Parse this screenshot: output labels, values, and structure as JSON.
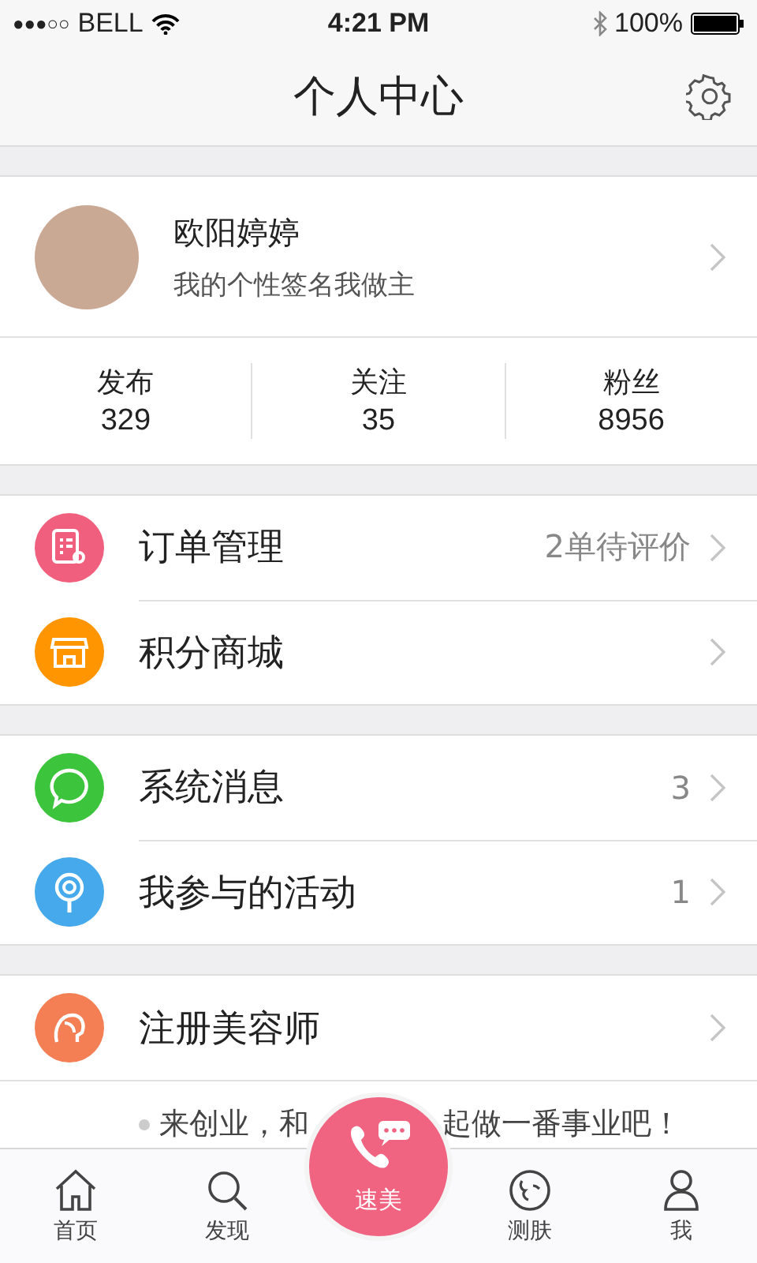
{
  "status_bar": {
    "signal": "●●●○○",
    "carrier": "BELL",
    "time": "4:21 PM",
    "battery": "100%"
  },
  "nav": {
    "title": "个人中心"
  },
  "profile": {
    "name": "欧阳婷婷",
    "signature": "我的个性签名我做主"
  },
  "stats": [
    {
      "label": "发布",
      "value": "329"
    },
    {
      "label": "关注",
      "value": "35"
    },
    {
      "label": "粉丝",
      "value": "8956"
    }
  ],
  "groups": [
    [
      {
        "kind": "order",
        "label": "订单管理",
        "detail": "2单待评价",
        "color": "#f0607e"
      },
      {
        "kind": "shop",
        "label": "积分商城",
        "color": "#ff9500"
      }
    ],
    [
      {
        "kind": "message",
        "label": "系统消息",
        "detail": "3",
        "color": "#3cc43c"
      },
      {
        "kind": "activity",
        "label": "我参与的活动",
        "detail": "1",
        "color": "#46a9ec"
      }
    ],
    [
      {
        "kind": "beautician",
        "label": "注册美容师",
        "color": "#f47f55"
      }
    ]
  ],
  "promo": {
    "before": "来创业，和",
    "after": "起做一番事业吧！"
  },
  "tabs": [
    {
      "kind": "home",
      "label": "首页",
      "selected": false
    },
    {
      "kind": "discover",
      "label": "发现",
      "selected": false
    },
    {
      "kind": "center",
      "label": "速美",
      "selected": false
    },
    {
      "kind": "skin",
      "label": "测肤",
      "selected": false
    },
    {
      "kind": "me",
      "label": "我",
      "selected": false
    }
  ]
}
